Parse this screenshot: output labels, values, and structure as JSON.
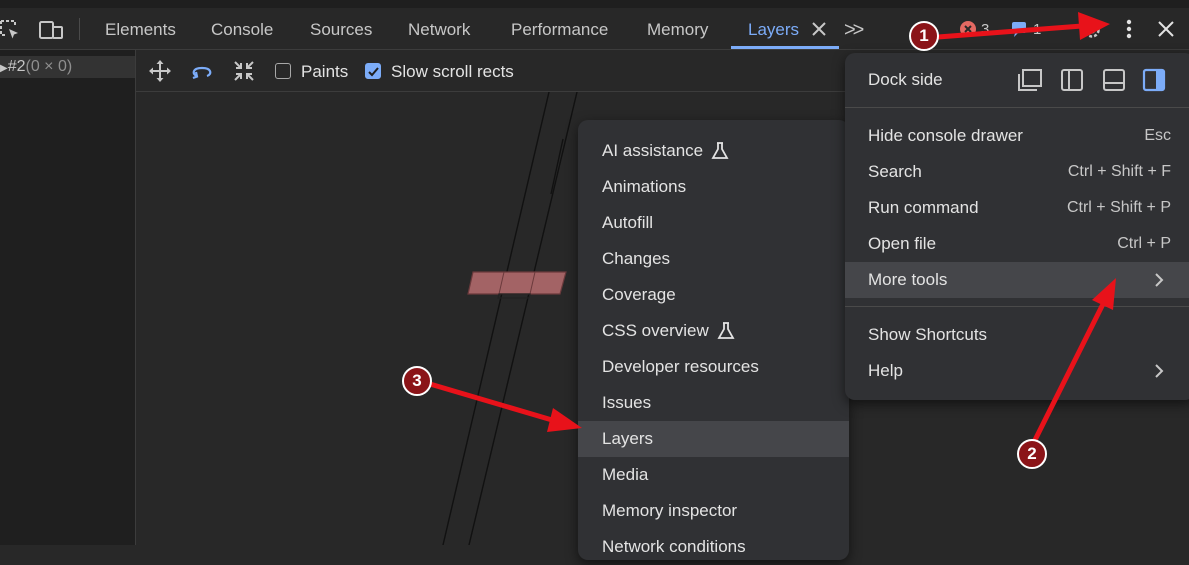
{
  "toolbar": {
    "tabs": [
      "Elements",
      "Console",
      "Sources",
      "Network",
      "Performance",
      "Memory",
      "Layers"
    ],
    "more_tabs_label": ">>",
    "error_count": "3",
    "message_count": "1"
  },
  "layer_tree": {
    "node_label": "#2",
    "node_size": "(0 × 0)"
  },
  "layers_toolbar": {
    "paints_label": "Paints",
    "paints_checked": false,
    "slow_scroll_label": "Slow scroll rects",
    "slow_scroll_checked": true
  },
  "main_menu": {
    "dock_side_label": "Dock side",
    "items": [
      {
        "label": "Hide console drawer",
        "shortcut": "Esc"
      },
      {
        "label": "Search",
        "shortcut": "Ctrl + Shift + F"
      },
      {
        "label": "Run command",
        "shortcut": "Ctrl + Shift + P"
      },
      {
        "label": "Open file",
        "shortcut": "Ctrl + P"
      },
      {
        "label": "More tools",
        "has_submenu": true,
        "highlighted": true
      }
    ],
    "items2": [
      {
        "label": "Show Shortcuts"
      },
      {
        "label": "Help",
        "has_submenu": true
      }
    ]
  },
  "more_tools_menu": {
    "items": [
      {
        "label": "AI assistance",
        "experimental": true
      },
      {
        "label": "Animations"
      },
      {
        "label": "Autofill"
      },
      {
        "label": "Changes"
      },
      {
        "label": "Coverage"
      },
      {
        "label": "CSS overview",
        "experimental": true
      },
      {
        "label": "Developer resources"
      },
      {
        "label": "Issues"
      },
      {
        "label": "Layers",
        "highlighted": true
      },
      {
        "label": "Media"
      },
      {
        "label": "Memory inspector"
      },
      {
        "label": "Network conditions"
      }
    ]
  },
  "annotations": {
    "badges": [
      "1",
      "2",
      "3"
    ],
    "color": "#e8121a"
  }
}
